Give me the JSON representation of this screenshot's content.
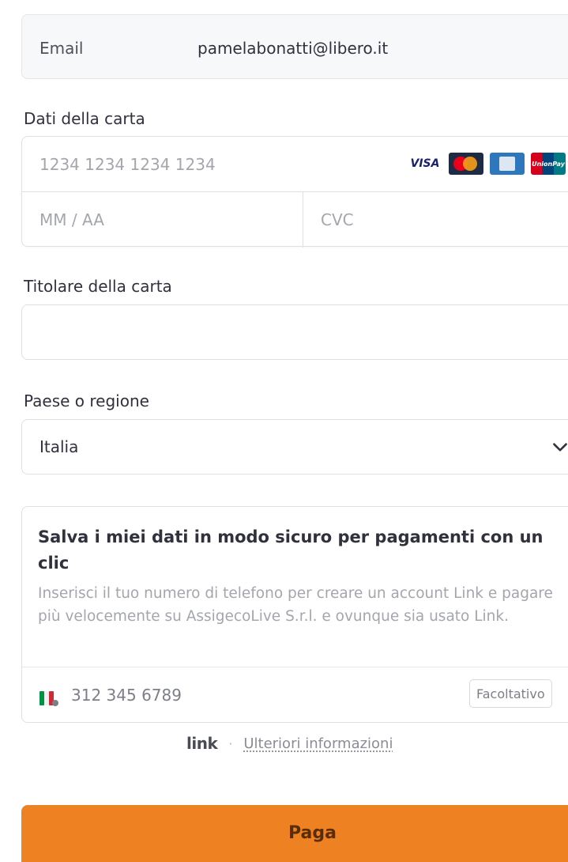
{
  "email": {
    "label": "Email",
    "value": "pamelabonatti@libero.it"
  },
  "card": {
    "section_label": "Dati della carta",
    "number_placeholder": "1234 1234 1234 1234",
    "expiry_placeholder": "MM / AA",
    "cvc_placeholder": "CVC",
    "brands": {
      "visa": "VISA",
      "unionpay": "UnionPay"
    }
  },
  "holder": {
    "label": "Titolare della carta",
    "value": ""
  },
  "country": {
    "label": "Paese o regione",
    "value": "Italia"
  },
  "link_save": {
    "title": "Salva i miei dati in modo sicuro per pagamenti con un clic",
    "description": "Inserisci il tuo numero di telefono per creare un account Link e pagare più velocemente su AssigecoLive S.r.l. e ovunque sia usato Link.",
    "phone_placeholder": "312 345 6789",
    "optional_label": "Facoltativo"
  },
  "footer": {
    "logo_text": "link",
    "separator": "·",
    "more_info": "Ulteriori informazioni"
  },
  "pay": {
    "label": "Paga",
    "color": "#ee8222"
  }
}
